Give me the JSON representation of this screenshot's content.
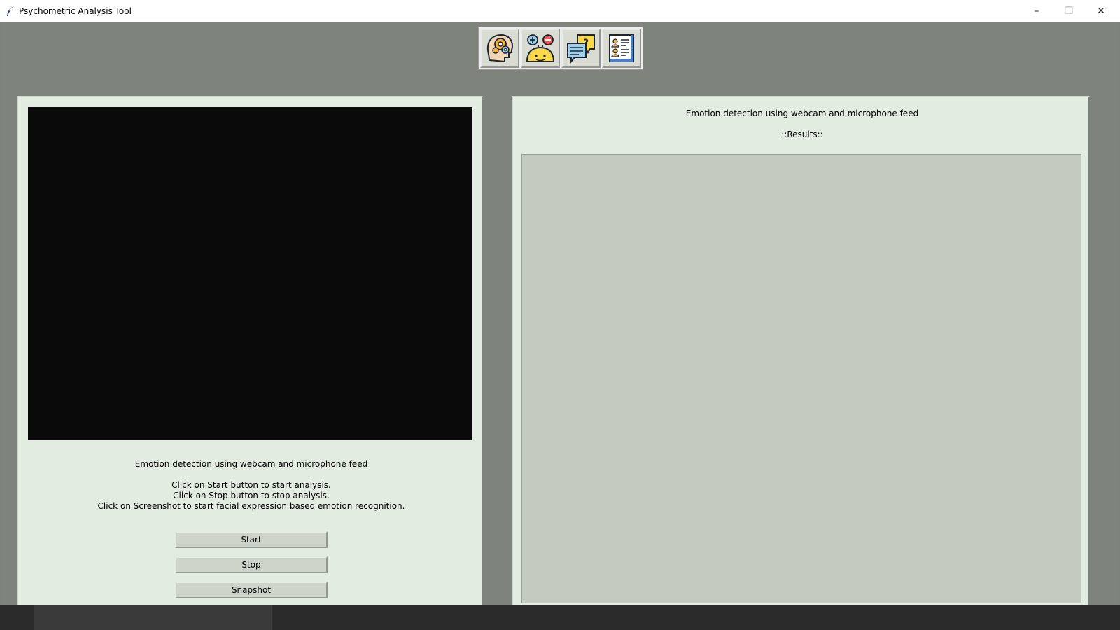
{
  "window": {
    "title": "Psychometric Analysis Tool",
    "controls": {
      "minimize": "–",
      "maximize": "❐",
      "close": "✕"
    }
  },
  "toolbar": {
    "buttons": [
      {
        "icon": "brain-gears-icon"
      },
      {
        "icon": "emotion-plus-minus-icon"
      },
      {
        "icon": "chat-question-icon"
      },
      {
        "icon": "profile-document-icon"
      }
    ]
  },
  "left_panel": {
    "heading": "Emotion detection using webcam and microphone feed",
    "instructions": [
      "Click on Start button to start analysis.",
      "Click on Stop button to stop analysis.",
      "Click on Screenshot to start facial expression based emotion recognition."
    ],
    "buttons": {
      "start": "Start",
      "stop": "Stop",
      "snapshot": "Snapshot"
    }
  },
  "right_panel": {
    "heading": "Emotion detection using webcam and microphone feed",
    "results_label": "::Results::"
  },
  "colors": {
    "panel_bg": "#e3ece1",
    "results_bg": "#c3cbc0",
    "video_bg": "#0a0a0a",
    "backdrop": "#7e847c"
  }
}
